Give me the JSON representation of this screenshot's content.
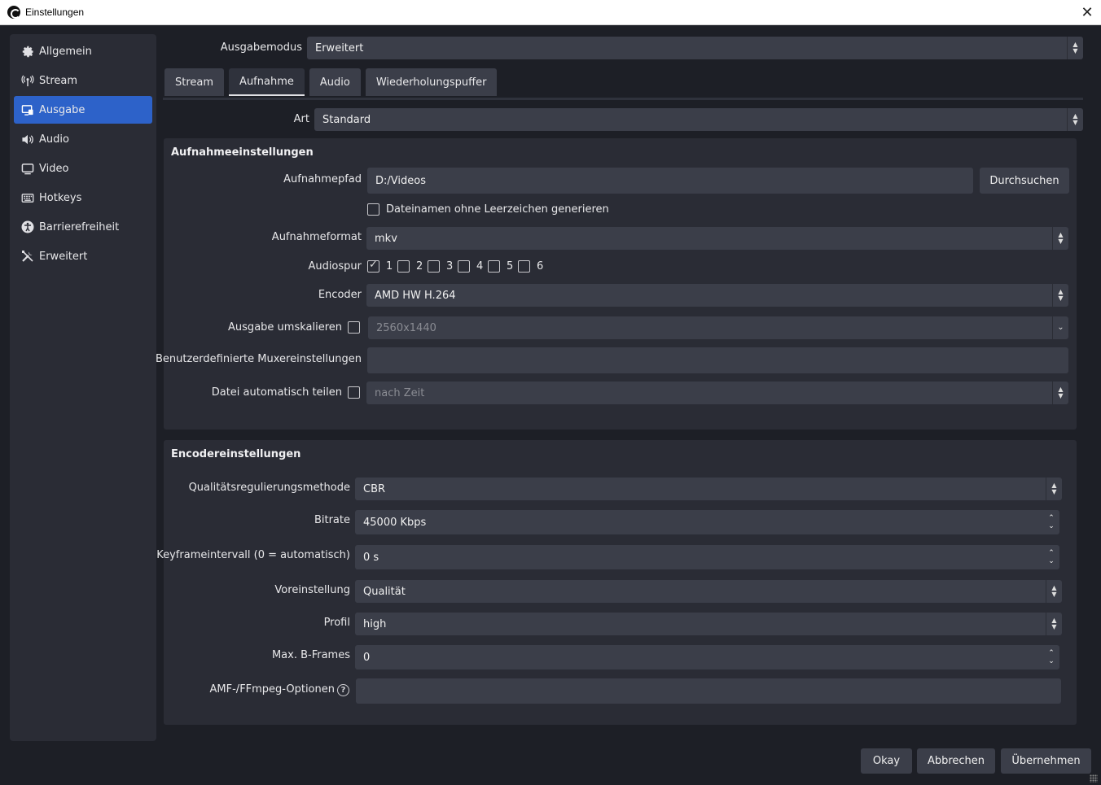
{
  "window": {
    "title": "Einstellungen",
    "close_symbol": "✕"
  },
  "sidebar": {
    "items": [
      {
        "label": "Allgemein",
        "icon": "gear-icon"
      },
      {
        "label": "Stream",
        "icon": "antenna-icon"
      },
      {
        "label": "Ausgabe",
        "icon": "output-icon",
        "active": true
      },
      {
        "label": "Audio",
        "icon": "speaker-icon"
      },
      {
        "label": "Video",
        "icon": "monitor-icon"
      },
      {
        "label": "Hotkeys",
        "icon": "keyboard-icon"
      },
      {
        "label": "Barrierefreiheit",
        "icon": "accessibility-icon"
      },
      {
        "label": "Erweitert",
        "icon": "tools-icon"
      }
    ]
  },
  "output_mode": {
    "label": "Ausgabemodus",
    "value": "Erweitert"
  },
  "tabs": [
    {
      "label": "Stream"
    },
    {
      "label": "Aufnahme",
      "active": true
    },
    {
      "label": "Audio"
    },
    {
      "label": "Wiederholungspuffer"
    }
  ],
  "type": {
    "label": "Art",
    "value": "Standard"
  },
  "recording": {
    "title": "Aufnahmeeinstellungen",
    "path_label": "Aufnahmepfad",
    "path_value": "D:/Videos",
    "browse_label": "Durchsuchen",
    "no_space_label": "Dateinamen ohne Leerzeichen generieren",
    "format_label": "Aufnahmeformat",
    "format_value": "mkv",
    "audio_track_label": "Audiospur",
    "tracks": [
      "1",
      "2",
      "3",
      "4",
      "5",
      "6"
    ],
    "tracks_checked": [
      true,
      false,
      false,
      false,
      false,
      false
    ],
    "encoder_label": "Encoder",
    "encoder_value": "AMD HW H.264",
    "rescale_label": "Ausgabe umskalieren",
    "rescale_value": "2560x1440",
    "mux_label": "Benutzerdefinierte Muxereinstellungen",
    "mux_value": "",
    "split_label": "Datei automatisch teilen",
    "split_value": "nach Zeit"
  },
  "encoder": {
    "title": "Encodereinstellungen",
    "rate_control_label": "Qualitätsregulierungsmethode",
    "rate_control_value": "CBR",
    "bitrate_label": "Bitrate",
    "bitrate_value": "45000 Kbps",
    "keyframe_label": "Keyframeintervall (0 = automatisch)",
    "keyframe_value": "0 s",
    "preset_label": "Voreinstellung",
    "preset_value": "Qualität",
    "profile_label": "Profil",
    "profile_value": "high",
    "bframes_label": "Max. B-Frames",
    "bframes_value": "0",
    "amf_label": "AMF-/FFmpeg-Optionen",
    "amf_value": "",
    "help_symbol": "?"
  },
  "footer": {
    "ok": "Okay",
    "cancel": "Abbrechen",
    "apply": "Übernehmen"
  }
}
